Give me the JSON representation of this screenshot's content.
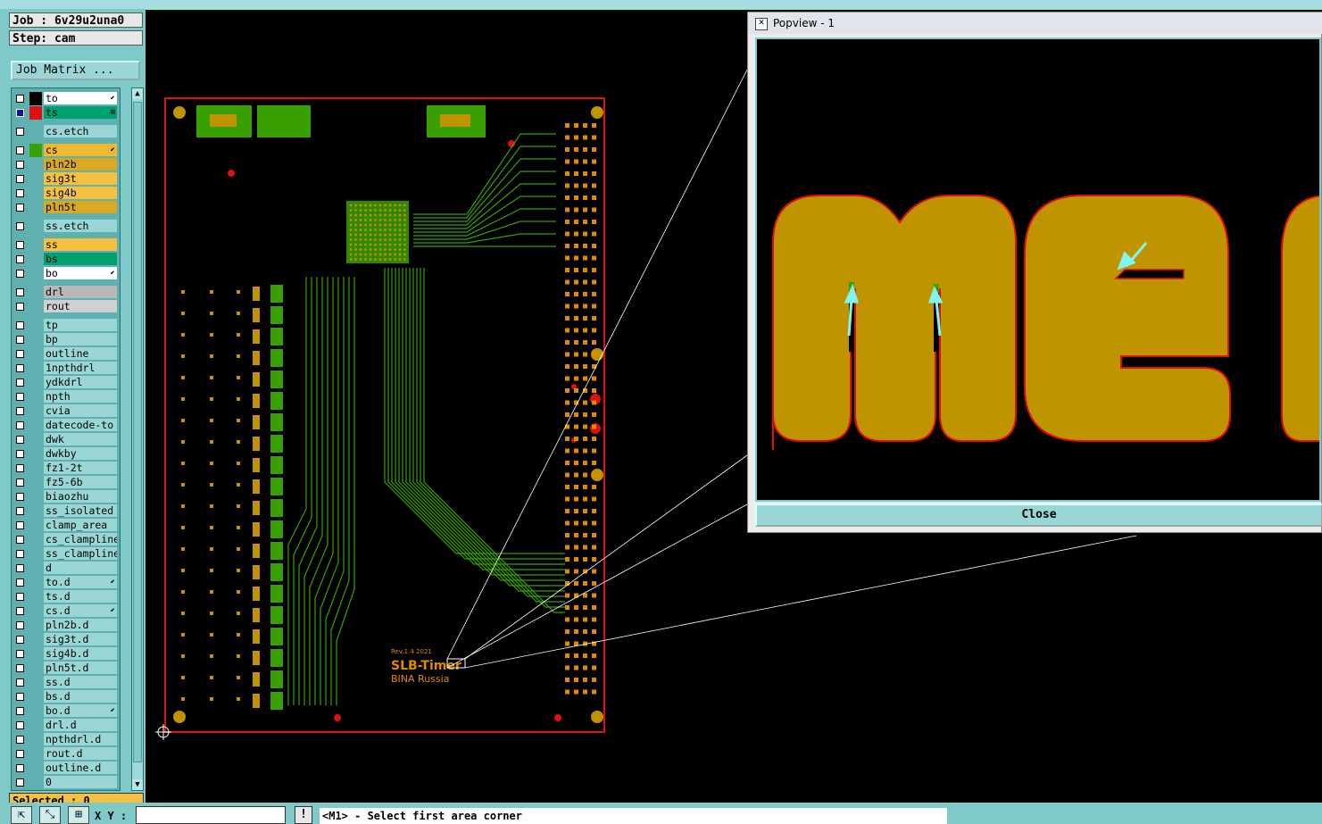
{
  "header": {
    "job_label": "Job : 6v29u2una0",
    "step_label": "Step: cam",
    "job_matrix_button": "Job Matrix ..."
  },
  "layers": [
    {
      "name": "to",
      "color": "#ffffff",
      "swatch": "#000000",
      "arrow": "⬋"
    },
    {
      "name": "ts",
      "color": "#00a070",
      "swatch": "#e01010",
      "arrow": "⊞",
      "selected": true
    },
    {
      "name": "cs.etch",
      "color": "#9ad6d6",
      "swatch": ""
    },
    {
      "name": "cs",
      "color": "#f0b830",
      "swatch": "#38a000",
      "arrow": "⬋"
    },
    {
      "name": "pln2b",
      "color": "#d8a820",
      "swatch": ""
    },
    {
      "name": "sig3t",
      "color": "#f5c040",
      "swatch": ""
    },
    {
      "name": "sig4b",
      "color": "#f5c040",
      "swatch": ""
    },
    {
      "name": "pln5t",
      "color": "#d8a820",
      "swatch": ""
    },
    {
      "name": "ss.etch",
      "color": "#9ad6d6",
      "swatch": ""
    },
    {
      "name": "ss",
      "color": "#f5c040",
      "swatch": ""
    },
    {
      "name": "bs",
      "color": "#00a070",
      "swatch": ""
    },
    {
      "name": "bo",
      "color": "#ffffff",
      "swatch": "",
      "arrow": "⬋"
    },
    {
      "name": "drl",
      "color": "#b8b8b8",
      "swatch": ""
    },
    {
      "name": "rout",
      "color": "#d0d0d0",
      "swatch": ""
    },
    {
      "name": "tp",
      "color": "#9ad6d6",
      "swatch": ""
    },
    {
      "name": "bp",
      "color": "#9ad6d6",
      "swatch": ""
    },
    {
      "name": "outline",
      "color": "#9ad6d6",
      "swatch": ""
    },
    {
      "name": "1npthdrl",
      "color": "#9ad6d6",
      "swatch": ""
    },
    {
      "name": "ydkdrl",
      "color": "#9ad6d6",
      "swatch": ""
    },
    {
      "name": "npth",
      "color": "#9ad6d6",
      "swatch": ""
    },
    {
      "name": "cvia",
      "color": "#9ad6d6",
      "swatch": ""
    },
    {
      "name": "datecode-to",
      "color": "#9ad6d6",
      "swatch": ""
    },
    {
      "name": "dwk",
      "color": "#9ad6d6",
      "swatch": ""
    },
    {
      "name": "dwkby",
      "color": "#9ad6d6",
      "swatch": ""
    },
    {
      "name": "fz1-2t",
      "color": "#9ad6d6",
      "swatch": ""
    },
    {
      "name": "fz5-6b",
      "color": "#9ad6d6",
      "swatch": ""
    },
    {
      "name": "biaozhu",
      "color": "#9ad6d6",
      "swatch": ""
    },
    {
      "name": "ss_isolated",
      "color": "#9ad6d6",
      "swatch": ""
    },
    {
      "name": "clamp_area",
      "color": "#9ad6d6",
      "swatch": ""
    },
    {
      "name": "cs_clampline",
      "color": "#9ad6d6",
      "swatch": ""
    },
    {
      "name": "ss_clampline",
      "color": "#9ad6d6",
      "swatch": ""
    },
    {
      "name": "d",
      "color": "#9ad6d6",
      "swatch": ""
    },
    {
      "name": "to.d",
      "color": "#9ad6d6",
      "swatch": "",
      "arrow": "⬋"
    },
    {
      "name": "ts.d",
      "color": "#9ad6d6",
      "swatch": ""
    },
    {
      "name": "cs.d",
      "color": "#9ad6d6",
      "swatch": "",
      "arrow": "⬋"
    },
    {
      "name": "pln2b.d",
      "color": "#9ad6d6",
      "swatch": ""
    },
    {
      "name": "sig3t.d",
      "color": "#9ad6d6",
      "swatch": ""
    },
    {
      "name": "sig4b.d",
      "color": "#9ad6d6",
      "swatch": ""
    },
    {
      "name": "pln5t.d",
      "color": "#9ad6d6",
      "swatch": ""
    },
    {
      "name": "ss.d",
      "color": "#9ad6d6",
      "swatch": ""
    },
    {
      "name": "bs.d",
      "color": "#9ad6d6",
      "swatch": ""
    },
    {
      "name": "bo.d",
      "color": "#9ad6d6",
      "swatch": "",
      "arrow": "⬋"
    },
    {
      "name": "drl.d",
      "color": "#9ad6d6",
      "swatch": ""
    },
    {
      "name": "npthdrl.d",
      "color": "#9ad6d6",
      "swatch": ""
    },
    {
      "name": "rout.d",
      "color": "#9ad6d6",
      "swatch": ""
    },
    {
      "name": "outline.d",
      "color": "#9ad6d6",
      "swatch": ""
    },
    {
      "name": "0",
      "color": "#9ad6d6",
      "swatch": ""
    }
  ],
  "selected_label": "Selected : 0",
  "bottom": {
    "xy_label": "X Y :",
    "xy_value": "",
    "exclaim": "!",
    "prompt": "<M1> - Select first area corner"
  },
  "board": {
    "silk_rev": "Rev.1.4   2021",
    "silk_title": "SLB-Timer",
    "silk_sub": "BINA Russia"
  },
  "popview": {
    "title": "Popview - 1",
    "close_label": "Close"
  },
  "colors": {
    "copper": "#c09400",
    "outline_red": "#e01010",
    "trace_green": "#38a000",
    "pad_orange": "#e08a00",
    "arrow_cyan": "#7ff5f0"
  }
}
